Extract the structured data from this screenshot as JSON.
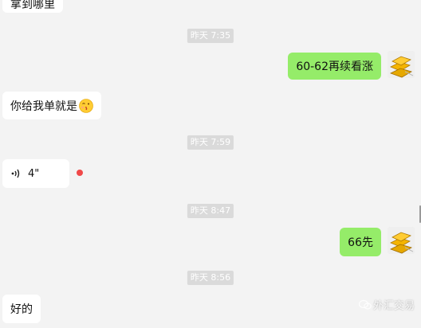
{
  "messages": {
    "top_partial": "拿到哪里",
    "sent_1": "60-62再续看涨",
    "received_1": "你给我单就是",
    "voice": {
      "duration": "4\""
    },
    "sent_2": "66先",
    "received_2": "好的"
  },
  "timestamps": {
    "t1": "昨天 7:35",
    "t2": "昨天 7:59",
    "t3": "昨天 8:47",
    "t4": "昨天 8:56"
  },
  "watermark": "外汇交易",
  "icons": {
    "emoji": "kiss-emoji-icon",
    "voice": "voice-wave-icon",
    "avatar": "gold-bars-avatar-icon",
    "watermark": "watermark-logo-icon"
  },
  "colors": {
    "background": "#f3f3f3",
    "sent_bubble": "#95ec69",
    "received_bubble": "#ffffff",
    "timestamp_bg": "#dadada",
    "unread_dot": "#f04848"
  }
}
